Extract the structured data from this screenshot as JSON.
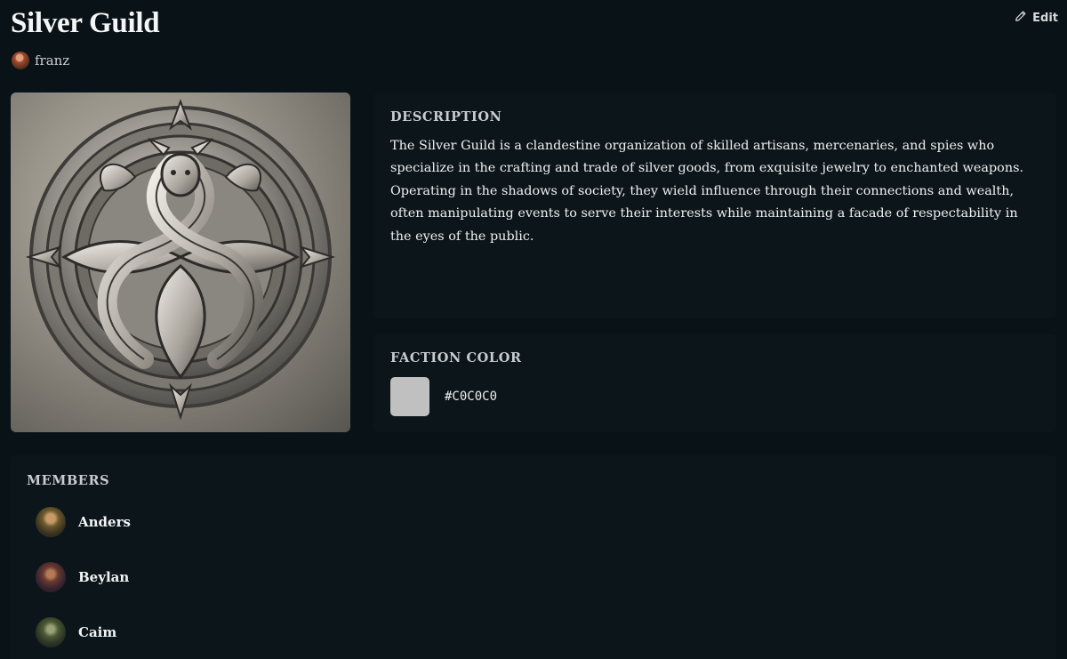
{
  "header": {
    "title": "Silver Guild",
    "owner_name": "franz",
    "edit_label": "Edit"
  },
  "description": {
    "label": "DESCRIPTION",
    "text": "The Silver Guild is a clandestine organization of skilled artisans, mercenaries, and spies who specialize in the crafting and trade of silver goods, from exquisite jewelry to enchanted weapons. Operating in the shadows of society, they wield influence through their connections and wealth, often manipulating events to serve their interests while maintaining a facade of respectability in the eyes of the public."
  },
  "faction_color": {
    "label": "FACTION COLOR",
    "hex": "#C0C0C0",
    "swatch_color": "#c0c0c0"
  },
  "members": {
    "label": "MEMBERS",
    "items": [
      {
        "name": "Anders"
      },
      {
        "name": "Beylan"
      },
      {
        "name": "Caim"
      }
    ]
  }
}
